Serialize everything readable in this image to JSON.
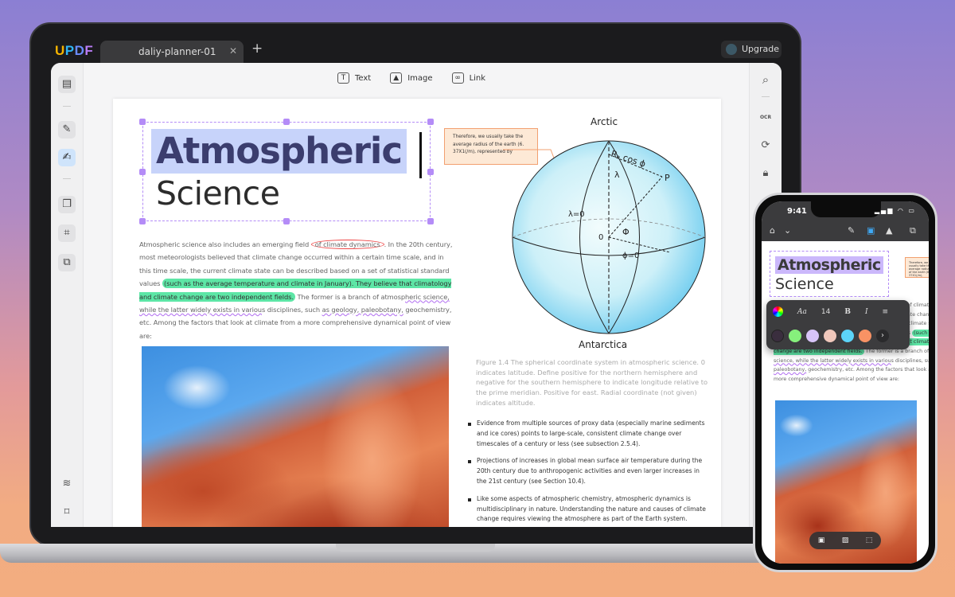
{
  "app": {
    "logo": [
      "U",
      "P",
      "D",
      "F"
    ],
    "tab_title": "daliy-planner-01",
    "tab_close": "✕",
    "new_tab": "+",
    "upgrade_label": "Upgrade"
  },
  "toolbar": {
    "text_label": "Text",
    "image_label": "Image",
    "link_label": "Link"
  },
  "left_sidebar": {
    "icons": [
      "reader-icon",
      "comment-icon",
      "edit-pdf-icon",
      "organize-pages-icon",
      "crop-icon",
      "convert-icon",
      "layers-icon",
      "bookmark-icon"
    ],
    "active": "edit-pdf-icon"
  },
  "right_sidebar": {
    "icons": [
      "search-icon",
      "ocr-icon",
      "convert-file-icon",
      "protect-file-icon"
    ],
    "ocr_label": "OCR"
  },
  "document": {
    "title_line1": "Atmospheric",
    "title_line2": "Science",
    "para": {
      "p1": "Atmospheric science also includes an emerging field ",
      "circled": "of climate dynamics",
      "p2": ". In the 20th century, most meteorologists believed that climate change occurred within a certain time scale, and in this time scale, the current climate state can be described based on a set of statistical standard values ",
      "highlight": "(such as the average temperature and climate in January). They believe that climatology and climate change are two independent fields.",
      "p3": " The former is a branch of atmosp",
      "wavy": "heric science, while the latter widely exists in variou",
      "p4": "s disciplines, such ",
      "wavy2": "as geology, paleobotany,",
      "p5": " geochemistry, etc. Among the factors that look at climate from a more comprehensive dynamical point of view are:"
    },
    "note": "Therefore, we usually take the average radius of the earth (6. 37X1(/m), represented by",
    "globe": {
      "top_label": "Arctic",
      "bottom_label": "Antarctica",
      "re_cos": "Rₑ cos ϕ",
      "lambda": "λ",
      "p": "P",
      "lambda0": "λ=0",
      "origin": "0",
      "phi": "Φ",
      "phi0": "ϕ=0"
    },
    "caption": "Figure 1.4 The spherical coordinate system in atmospheric science. 0 indicates latitude. Define positive for the northern hemisphere and negative for the southern hemisphere to indicate longitude relative to the prime meridian. Positive for east. Radial coordinate (not given) indicates altitude.",
    "bullets": [
      "Evidence from multiple sources of proxy data (especially marine sediments and ice cores) points to large-scale, consistent climate change over timescales of a century or less (see subsection 2.5.4).",
      "Projections of increases in global mean surface air temperature during the 20th century due to anthropogenic activities and even larger increases in the 21st century (see Section 10.4).",
      "Like some aspects of atmospheric chemistry, atmospheric dynamics is multidisciplinary in nature. Understanding the nature and causes of climate change requires viewing the atmosphere as part of the Earth system."
    ]
  },
  "phone": {
    "time": "9:41",
    "status": "▂▄▆ ◠ ▭",
    "palette": {
      "font_icon": "Aa",
      "font_size": "14",
      "bold": "B",
      "italic": "I",
      "colors": [
        "#3a2e3e",
        "#86f07c",
        "#d8c4f8",
        "#f0c8bc",
        "#5cd4f8",
        "#f99264"
      ],
      "more": "›"
    },
    "bottom_bar": [
      "text-tool-icon",
      "image-tool-icon",
      "select-tool-icon"
    ]
  }
}
